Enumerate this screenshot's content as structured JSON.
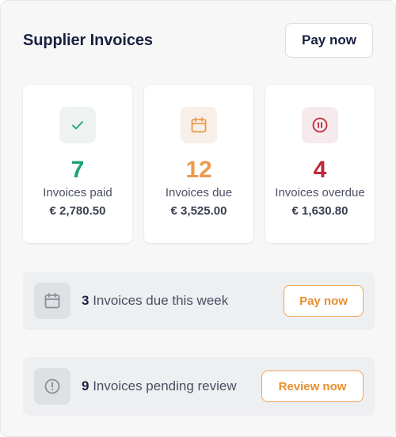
{
  "header": {
    "title": "Supplier Invoices",
    "pay_now_label": "Pay now"
  },
  "stats": [
    {
      "count": "7",
      "label": "Invoices paid",
      "amount": "€ 2,780.50",
      "color": "#1aa36f",
      "icon_bg": "#eef3f1",
      "icon": "check-icon"
    },
    {
      "count": "12",
      "label": "Invoices due",
      "amount": "€ 3,525.00",
      "color": "#ec9a4c",
      "icon_bg": "#f7efe8",
      "icon": "calendar-icon"
    },
    {
      "count": "4",
      "label": "Invoices overdue",
      "amount": "€ 1,630.80",
      "color": "#c0283a",
      "icon_bg": "#f6eaec",
      "icon": "pause-icon"
    }
  ],
  "rows": [
    {
      "count": "3",
      "text": "Invoices due this week",
      "button": "Pay now",
      "icon": "calendar-icon"
    },
    {
      "count": "9",
      "text": "Invoices pending review",
      "button": "Review now",
      "icon": "alert-circle-icon"
    }
  ]
}
